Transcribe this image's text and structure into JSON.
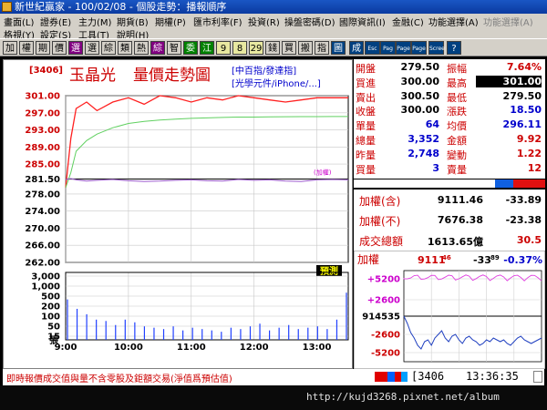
{
  "window": {
    "title": "新世紀贏家 - 100/02/08 - 個股走勢：播報順序"
  },
  "menu": {
    "row1": [
      "畫面(L)",
      "證券(E)",
      "主力(M)",
      "期貨(B)",
      "期權(P)",
      "匯市利率(F)",
      "投資(R)",
      "操盤密碼(D)",
      "國際資訊(I)",
      "金融(C)",
      "功能選擇(A)",
      "功能選擇(A)"
    ],
    "row2": [
      "格視(Y)",
      "設定(S)",
      "工具(T)",
      "說明(H)"
    ]
  },
  "toolbar": {
    "buttons": [
      "加",
      "權",
      "期",
      "價",
      "選",
      "選",
      "綜",
      "類",
      "熱",
      "綜",
      "智",
      "委",
      "江",
      "9",
      "8",
      "29",
      "錢",
      "買",
      "搬",
      "指",
      "圖",
      "成",
      "Esc",
      "Pag",
      "Page",
      "Page",
      "Scree",
      "?"
    ]
  },
  "chart": {
    "code": "[3406]",
    "name": "玉晶光",
    "title": "量價走勢圖",
    "index_link1": "[中百指/發達指]",
    "index_link2": "[光學元件/iPhone/...]",
    "price_ticks": [
      "301.00",
      "297.00",
      "293.00",
      "289.00",
      "285.00",
      "281.50",
      "278.00",
      "274.00",
      "270.00",
      "266.00",
      "262.00"
    ],
    "ref_label": "(加權)",
    "forecast_label": "預測",
    "volume_ticks": [
      "3,000",
      "1,000",
      "500",
      "200",
      "100",
      "50",
      "15"
    ],
    "volume_unit": "張",
    "time_ticks": [
      "9:00",
      "10:00",
      "11:00",
      "12:00",
      "13:00"
    ]
  },
  "chart_data": {
    "type": "line",
    "title": "量價走勢圖",
    "x": [
      "9:00",
      "9:05",
      "9:10",
      "9:20",
      "9:30",
      "9:45",
      "10:00",
      "10:15",
      "10:30",
      "10:45",
      "11:00",
      "11:15",
      "11:30",
      "11:45",
      "12:00",
      "12:15",
      "12:30",
      "12:45",
      "13:00",
      "13:15",
      "13:30"
    ],
    "series": [
      {
        "values": [
          279.5,
          291.0,
          298.0,
          299.5,
          297.5,
          299.5,
          300.5,
          299.0,
          301.0,
          300.5,
          299.5,
          300.5,
          300.0,
          301.0,
          300.5,
          300.0,
          299.5,
          300.0,
          300.5,
          300.5,
          300.5
        ]
      },
      {
        "values": [
          279.5,
          283.0,
          288.0,
          290.5,
          292.0,
          293.5,
          294.5,
          295.0,
          295.3,
          295.5,
          295.7,
          295.8,
          295.9,
          296.0,
          296.0,
          296.05,
          296.08,
          296.1,
          296.1,
          296.11,
          296.11
        ]
      },
      {
        "values": [
          281.4,
          281.6,
          281.3,
          281.0,
          281.2,
          281.4,
          281.1,
          280.9,
          281.0,
          281.2,
          281.3,
          281.1,
          281.0,
          281.4,
          281.2,
          281.3,
          281.0,
          280.9,
          281.3,
          281.4,
          281.3
        ]
      }
    ],
    "ylim": [
      262.0,
      301.0
    ]
  },
  "quote": {
    "rows": [
      {
        "l1": "開盤",
        "v1": "279.50",
        "l2": "振幅",
        "v2": "7.64%"
      },
      {
        "l1": "買進",
        "v1": "300.00",
        "l2": "最高",
        "v2": "301.00"
      },
      {
        "l1": "賣出",
        "v1": "300.50",
        "l2": "最低",
        "v2": "279.50"
      },
      {
        "l1": "收盤",
        "v1": "300.00",
        "l2": "漲跌",
        "v2": "18.50"
      },
      {
        "l1": "單量",
        "v1": "64",
        "l2": "均價",
        "v2": "296.11"
      },
      {
        "l1": "總量",
        "v1": "3,352",
        "l2": "金額",
        "v2": "9.92"
      },
      {
        "l1": "昨量",
        "v1": "2,748",
        "l2": "變動",
        "v2": "1.22"
      },
      {
        "l1": "買量",
        "v1": "3",
        "l2": "賣量",
        "v2": "12"
      }
    ]
  },
  "index": {
    "rows": [
      {
        "label": "加權(含)",
        "value": "9111.46",
        "change": "-33.89"
      },
      {
        "label": "加權(不)",
        "value": "7676.38",
        "change": "-23.38"
      },
      {
        "label": "成交總額",
        "value": "1613.65億",
        "change": "30.5"
      }
    ]
  },
  "mini": {
    "label": "加權",
    "value_main": "9111",
    "value_frac": "46",
    "change_main": "-33",
    "change_frac": "89",
    "pct": "-0.37%",
    "ticks": [
      "+5200",
      "+2600",
      "914535",
      "-2600",
      "-5200"
    ]
  },
  "status": {
    "message": "即時報價成交值與量不含零股及鉅額交易(淨值爲預估值)",
    "code": "[3406",
    "time": "13:36:35"
  },
  "watermark": "http://kujd3268.pixnet.net/album"
}
